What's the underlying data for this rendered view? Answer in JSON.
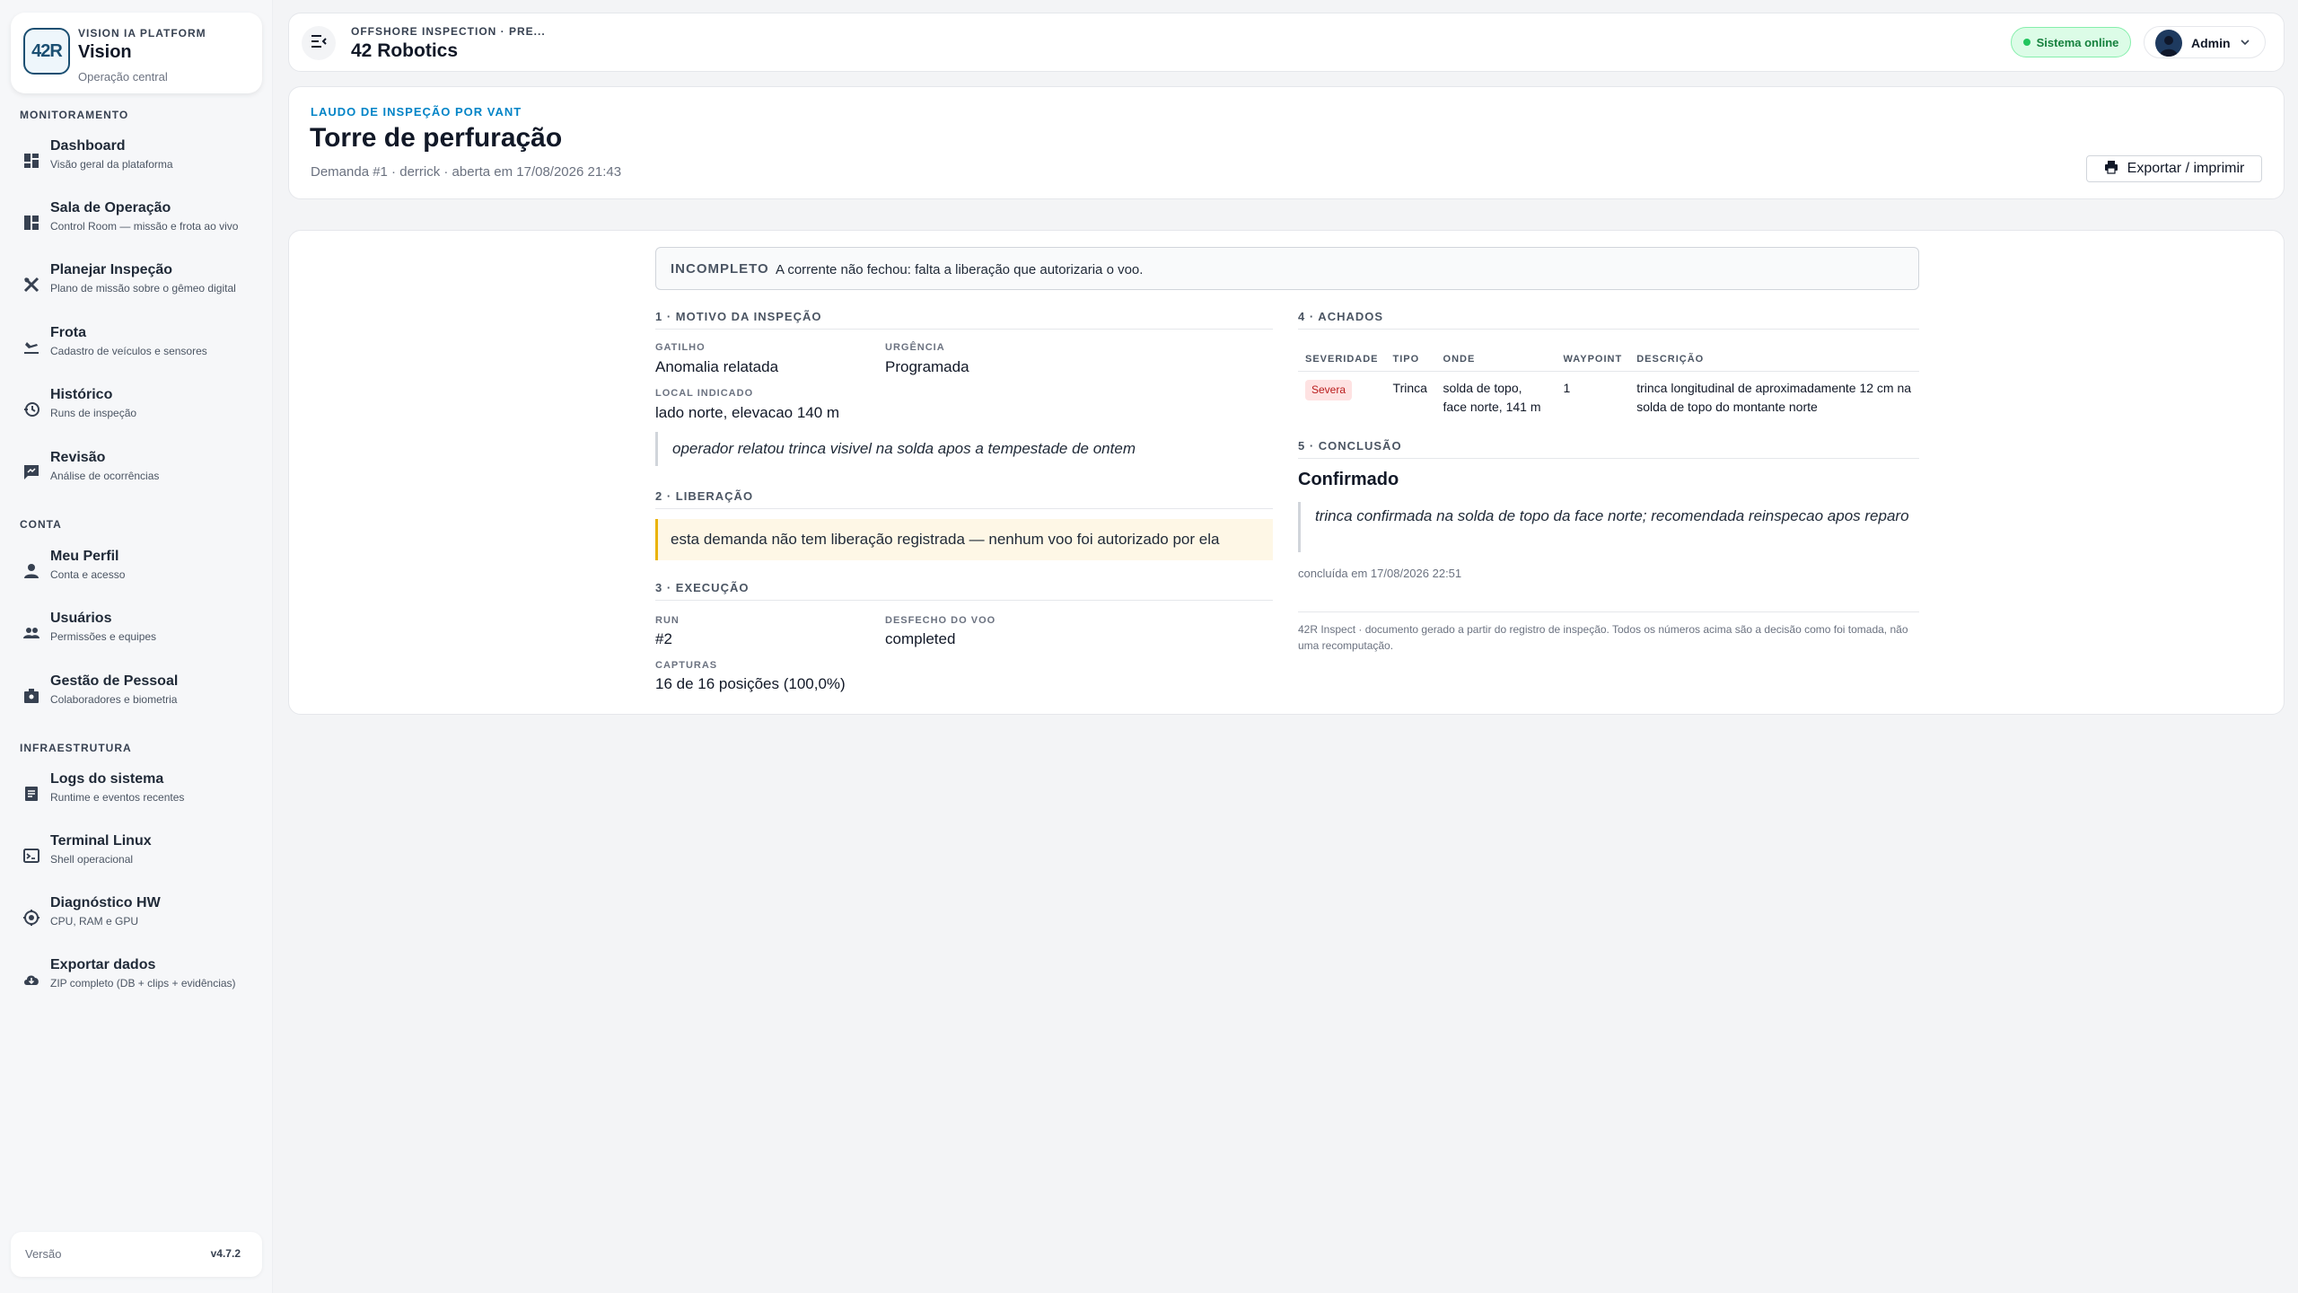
{
  "sidebar": {
    "brand": {
      "logo_text": "42R",
      "eyebrow": "VISION IA PLATFORM",
      "title": "Vision",
      "subtitle": "Operação central"
    },
    "sections": [
      {
        "title": "MONITORAMENTO"
      },
      {
        "title": "CONTA"
      },
      {
        "title": "INFRAESTRUTURA"
      }
    ],
    "items": [
      {
        "label": "Dashboard",
        "desc": "Visão geral da plataforma",
        "icon": "dashboard-icon"
      },
      {
        "label": "Sala de Operação",
        "desc": "Control Room — missão e frota ao vivo",
        "icon": "control-room-icon"
      },
      {
        "label": "Planejar Inspeção",
        "desc": "Plano de missão sobre o gêmeo digital",
        "icon": "tools-icon"
      },
      {
        "label": "Frota",
        "desc": "Cadastro de veículos e sensores",
        "icon": "plane-icon"
      },
      {
        "label": "Histórico",
        "desc": "Runs de inspeção",
        "icon": "history-icon"
      },
      {
        "label": "Revisão",
        "desc": "Análise de ocorrências",
        "icon": "review-icon"
      },
      {
        "label": "Meu Perfil",
        "desc": "Conta e acesso",
        "icon": "person-icon"
      },
      {
        "label": "Usuários",
        "desc": "Permissões e equipes",
        "icon": "group-icon"
      },
      {
        "label": "Gestão de Pessoal",
        "desc": "Colaboradores e biometria",
        "icon": "badge-icon"
      },
      {
        "label": "Logs do sistema",
        "desc": "Runtime e eventos recentes",
        "icon": "logs-icon"
      },
      {
        "label": "Terminal Linux",
        "desc": "Shell operacional",
        "icon": "terminal-icon"
      },
      {
        "label": "Diagnóstico HW",
        "desc": "CPU, RAM e GPU",
        "icon": "hardware-icon"
      },
      {
        "label": "Exportar dados",
        "desc": "ZIP completo (DB + clips + evidências)",
        "icon": "cloud-download-icon"
      }
    ],
    "version": {
      "label": "Versão",
      "value": "v4.7.2"
    }
  },
  "topbar": {
    "eyebrow": "OFFSHORE INSPECTION · PRE...",
    "title": "42 Robotics",
    "status": "Sistema online",
    "user": "Admin"
  },
  "report_header": {
    "eyebrow": "LAUDO DE INSPEÇÃO POR VANT",
    "title": "Torre de perfuração",
    "meta": "Demanda #1 · derrick · aberta em 17/08/2026 21:43",
    "export_label": "Exportar / imprimir"
  },
  "report": {
    "alert": {
      "tag": "INCOMPLETO",
      "text": "A corrente não fechou: falta a liberação que autorizaria o voo."
    },
    "motivo": {
      "title": "1 · MOTIVO DA INSPEÇÃO",
      "gatilho_label": "GATILHO",
      "gatilho_value": "Anomalia relatada",
      "urgencia_label": "URGÊNCIA",
      "urgencia_value": "Programada",
      "local_label": "LOCAL INDICADO",
      "local_value": "lado norte, elevacao 140 m",
      "quote": "operador relatou trinca visivel na solda apos a tempestade de ontem"
    },
    "liberacao": {
      "title": "2 · LIBERAÇÃO",
      "warning": "esta demanda não tem liberação registrada — nenhum voo foi autorizado por ela"
    },
    "execucao": {
      "title": "3 · EXECUÇÃO",
      "run_label": "RUN",
      "run_value": "#2",
      "desfecho_label": "DESFECHO DO VOO",
      "desfecho_value": "completed",
      "capturas_label": "CAPTURAS",
      "capturas_value": "16 de 16 posições (100,0%)"
    },
    "achados": {
      "title": "4 · ACHADOS",
      "columns": [
        "SEVERIDADE",
        "TIPO",
        "ONDE",
        "WAYPOINT",
        "DESCRIÇÃO"
      ],
      "rows": [
        {
          "severidade": "Severa",
          "tipo": "Trinca",
          "onde": "solda de topo, face norte, 141 m",
          "waypoint": "1",
          "descricao": "trinca longitudinal de aproximadamente 12 cm na solda de topo do montante norte"
        }
      ]
    },
    "conclusao": {
      "title": "5 · CONCLUSÃO",
      "verdict": "Confirmado",
      "quote": "trinca confirmada na solda de topo da face norte; recomendada reinspecao apos reparo",
      "date": "concluída em 17/08/2026 22:51"
    },
    "footer": "42R Inspect · documento gerado a partir do registro de inspeção. Todos os números acima são a decisão como foi tomada, não uma recomputação."
  },
  "colors": {
    "accent": "#0284c7",
    "status_online": "#22c55e",
    "severity_high": "#b91c1c",
    "warning_border": "#eab308"
  }
}
